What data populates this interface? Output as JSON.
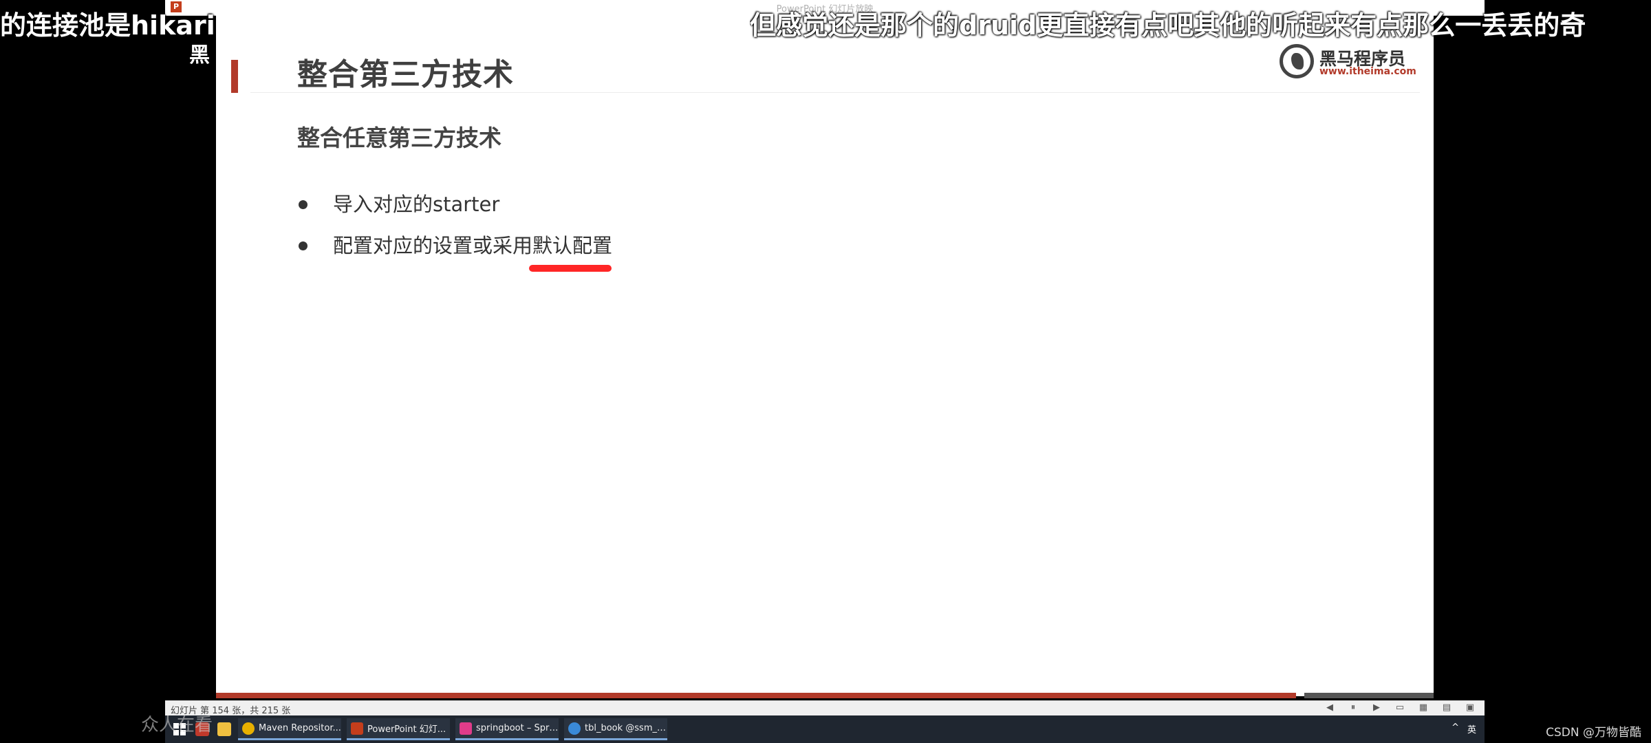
{
  "window": {
    "title": "PowerPoint 幻灯片放映"
  },
  "captions": {
    "top_left": "的连接池是hikari",
    "top_left_line2": "黑",
    "top_right": "但感觉还是那个的druid更直接有点吧其他的听起来有点那么一丢丢的奇"
  },
  "slide": {
    "title": "整合第三方技术",
    "subtitle": "整合任意第三方技术",
    "bullets": [
      {
        "text": "导入对应的starter"
      },
      {
        "text": "配置对应的设置或采用默认配置"
      }
    ],
    "logo": {
      "brand": "黑马程序员",
      "url": "www.itheima.com"
    },
    "colors": {
      "accent": "#b23a2a",
      "underline": "#ff1a1a"
    }
  },
  "status_bar": {
    "slide_count": "幻灯片 第 154 张，共 215 张"
  },
  "taskbar": {
    "tasks": [
      {
        "label": "Maven Repositor...",
        "icon": "chrome-icon",
        "color": "#e8b000"
      },
      {
        "label": "PowerPoint 幻灯...",
        "icon": "powerpoint-icon",
        "color": "#c43e1c"
      },
      {
        "label": "springboot – Spri...",
        "icon": "intellij-icon",
        "color": "#e03c8a"
      },
      {
        "label": "tbl_book @ssm_d...",
        "icon": "navicat-icon",
        "color": "#3a8ad8"
      }
    ],
    "ime": "英"
  },
  "overlay": {
    "left_text": "众人在看"
  },
  "watermark": "CSDN @万物皆酷"
}
